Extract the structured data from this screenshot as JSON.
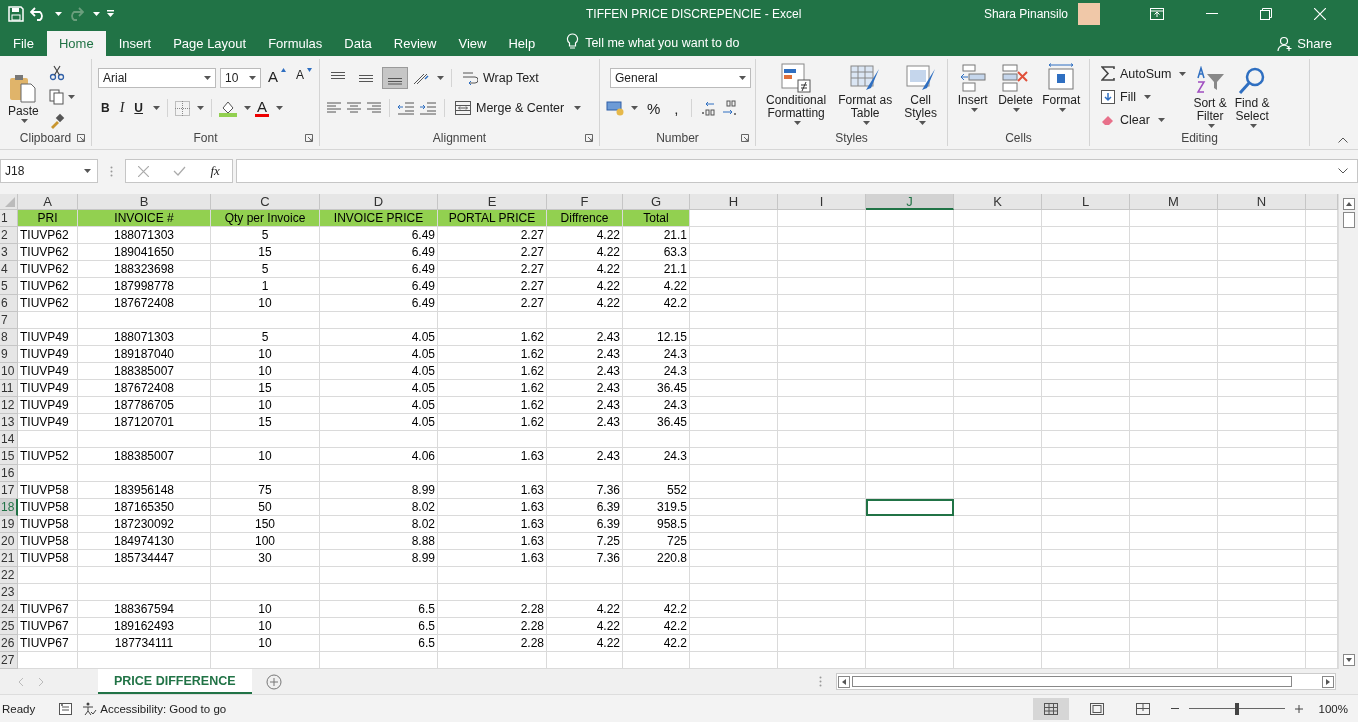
{
  "title_bar": {
    "title": "TIFFEN PRICE DISCREPENCIE  -  Excel",
    "user": "Shara Pinansilo"
  },
  "menu_tabs": [
    {
      "label": "File",
      "selected": false
    },
    {
      "label": "Home",
      "selected": true
    },
    {
      "label": "Insert",
      "selected": false
    },
    {
      "label": "Page Layout",
      "selected": false
    },
    {
      "label": "Formulas",
      "selected": false
    },
    {
      "label": "Data",
      "selected": false
    },
    {
      "label": "Review",
      "selected": false
    },
    {
      "label": "View",
      "selected": false
    },
    {
      "label": "Help",
      "selected": false
    }
  ],
  "tell_me": "Tell me what you want to do",
  "share": "Share",
  "ribbon": {
    "clipboard": {
      "paste": "Paste",
      "label": "Clipboard"
    },
    "font": {
      "font_name": "Arial",
      "font_size": "10",
      "grow": "A",
      "shrink": "A",
      "bold": "B",
      "italic": "I",
      "underline": "U",
      "font_color": "A",
      "label": "Font"
    },
    "alignment": {
      "vertical": [
        {
          "kind": "top",
          "selected": false
        },
        {
          "kind": "middle",
          "selected": false
        },
        {
          "kind": "bottom",
          "selected": true
        }
      ],
      "wrap_text": "Wrap Text",
      "merge_center": "Merge & Center",
      "label": "Alignment"
    },
    "number": {
      "format": "General",
      "percent": "%",
      "comma": ",",
      "label": "Number"
    },
    "styles": {
      "buttons": [
        {
          "kind": "conditional",
          "label": "Conditional\nFormatting"
        },
        {
          "kind": "table",
          "label": "Format as\nTable"
        },
        {
          "kind": "cell",
          "label": "Cell\nStyles"
        }
      ],
      "label": "Styles"
    },
    "cells": {
      "buttons": [
        {
          "kind": "insert",
          "label": "Insert"
        },
        {
          "kind": "delete",
          "label": "Delete"
        },
        {
          "kind": "format",
          "label": "Format"
        }
      ],
      "label": "Cells"
    },
    "editing": {
      "autosum": "AutoSum",
      "fill": "Fill",
      "clear": "Clear",
      "sort_filter": "Sort &\nFilter",
      "find_select": "Find &\nSelect",
      "label": "Editing"
    }
  },
  "formula_bar": {
    "name_box": "J18",
    "function_label": "fx"
  },
  "sheet": {
    "columns": [
      {
        "label": "A",
        "selected": false
      },
      {
        "label": "B",
        "selected": false
      },
      {
        "label": "C",
        "selected": false
      },
      {
        "label": "D",
        "selected": false
      },
      {
        "label": "E",
        "selected": false
      },
      {
        "label": "F",
        "selected": false
      },
      {
        "label": "G",
        "selected": false
      },
      {
        "label": "H",
        "selected": false
      },
      {
        "label": "I",
        "selected": false
      },
      {
        "label": "J",
        "selected": true
      },
      {
        "label": "K",
        "selected": false
      },
      {
        "label": "L",
        "selected": false
      },
      {
        "label": "M",
        "selected": false
      },
      {
        "label": "N",
        "selected": false
      }
    ],
    "rows": [
      {
        "number": "1",
        "selected": false,
        "kind": "header",
        "cells": [
          "PRI",
          "INVOICE #",
          "Qty per Invoice",
          "INVOICE PRICE",
          "PORTAL PRICE",
          "Diffrence",
          "Total"
        ]
      },
      {
        "number": "2",
        "selected": false,
        "kind": "data",
        "cells": [
          "TIUVP62",
          "188071303",
          "5",
          "6.49",
          "2.27",
          "4.22",
          "21.1"
        ]
      },
      {
        "number": "3",
        "selected": false,
        "kind": "data",
        "cells": [
          "TIUVP62",
          "189041650",
          "15",
          "6.49",
          "2.27",
          "4.22",
          "63.3"
        ]
      },
      {
        "number": "4",
        "selected": false,
        "kind": "data",
        "cells": [
          "TIUVP62",
          "188323698",
          "5",
          "6.49",
          "2.27",
          "4.22",
          "21.1"
        ]
      },
      {
        "number": "5",
        "selected": false,
        "kind": "data",
        "cells": [
          "TIUVP62",
          "187998778",
          "1",
          "6.49",
          "2.27",
          "4.22",
          "4.22"
        ]
      },
      {
        "number": "6",
        "selected": false,
        "kind": "data",
        "cells": [
          "TIUVP62",
          "187672408",
          "10",
          "6.49",
          "2.27",
          "4.22",
          "42.2"
        ]
      },
      {
        "number": "7",
        "selected": false,
        "kind": "data"
      },
      {
        "number": "8",
        "selected": false,
        "kind": "data",
        "cells": [
          "TIUVP49",
          "188071303",
          "5",
          "4.05",
          "1.62",
          "2.43",
          "12.15"
        ]
      },
      {
        "number": "9",
        "selected": false,
        "kind": "data",
        "cells": [
          "TIUVP49",
          "189187040",
          "10",
          "4.05",
          "1.62",
          "2.43",
          "24.3"
        ]
      },
      {
        "number": "10",
        "selected": false,
        "kind": "data",
        "cells": [
          "TIUVP49",
          "188385007",
          "10",
          "4.05",
          "1.62",
          "2.43",
          "24.3"
        ]
      },
      {
        "number": "11",
        "selected": false,
        "kind": "data",
        "cells": [
          "TIUVP49",
          "187672408",
          "15",
          "4.05",
          "1.62",
          "2.43",
          "36.45"
        ]
      },
      {
        "number": "12",
        "selected": false,
        "kind": "data",
        "cells": [
          "TIUVP49",
          "187786705",
          "10",
          "4.05",
          "1.62",
          "2.43",
          "24.3"
        ]
      },
      {
        "number": "13",
        "selected": false,
        "kind": "data",
        "cells": [
          "TIUVP49",
          "187120701",
          "15",
          "4.05",
          "1.62",
          "2.43",
          "36.45"
        ]
      },
      {
        "number": "14",
        "selected": false,
        "kind": "data"
      },
      {
        "number": "15",
        "selected": false,
        "kind": "data",
        "cells": [
          "TIUVP52",
          "188385007",
          "10",
          "4.06",
          "1.63",
          "2.43",
          "24.3"
        ]
      },
      {
        "number": "16",
        "selected": false,
        "kind": "data"
      },
      {
        "number": "17",
        "selected": false,
        "kind": "data",
        "cells": [
          "TIUVP58",
          "183956148",
          "75",
          "8.99",
          "1.63",
          "7.36",
          "552"
        ]
      },
      {
        "number": "18",
        "selected": true,
        "kind": "data",
        "cells": [
          "TIUVP58",
          "187165350",
          "50",
          "8.02",
          "1.63",
          "6.39",
          "319.5"
        ]
      },
      {
        "number": "19",
        "selected": false,
        "kind": "data",
        "cells": [
          "TIUVP58",
          "187230092",
          "150",
          "8.02",
          "1.63",
          "6.39",
          "958.5"
        ]
      },
      {
        "number": "20",
        "selected": false,
        "kind": "data",
        "cells": [
          "TIUVP58",
          "184974130",
          "100",
          "8.88",
          "1.63",
          "7.25",
          "725"
        ]
      },
      {
        "number": "21",
        "selected": false,
        "kind": "data",
        "cells": [
          "TIUVP58",
          "185734447",
          "30",
          "8.99",
          "1.63",
          "7.36",
          "220.8"
        ]
      },
      {
        "number": "22",
        "selected": false,
        "kind": "data"
      },
      {
        "number": "23",
        "selected": false,
        "kind": "data"
      },
      {
        "number": "24",
        "selected": false,
        "kind": "data",
        "cells": [
          "TIUVP67",
          "188367594",
          "10",
          "6.5",
          "2.28",
          "4.22",
          "42.2"
        ]
      },
      {
        "number": "25",
        "selected": false,
        "kind": "data",
        "cells": [
          "TIUVP67",
          "189162493",
          "10",
          "6.5",
          "2.28",
          "4.22",
          "42.2"
        ]
      },
      {
        "number": "26",
        "selected": false,
        "kind": "data",
        "cells": [
          "TIUVP67",
          "187734111",
          "10",
          "6.5",
          "2.28",
          "4.22",
          "42.2"
        ]
      },
      {
        "number": "27",
        "selected": false,
        "kind": "data"
      }
    ]
  },
  "sheet_tabs": [
    {
      "label": "PRICE DIFFERENCE",
      "selected": true
    }
  ],
  "status_bar": {
    "mode": "Ready",
    "accessibility": "Accessibility: Good to go",
    "views": [
      {
        "kind": "normal",
        "selected": true
      },
      {
        "kind": "page_layout",
        "selected": false
      },
      {
        "kind": "page_break",
        "selected": false
      }
    ],
    "zoom_slider": {
      "level": 0.5
    },
    "zoom": "100%"
  }
}
